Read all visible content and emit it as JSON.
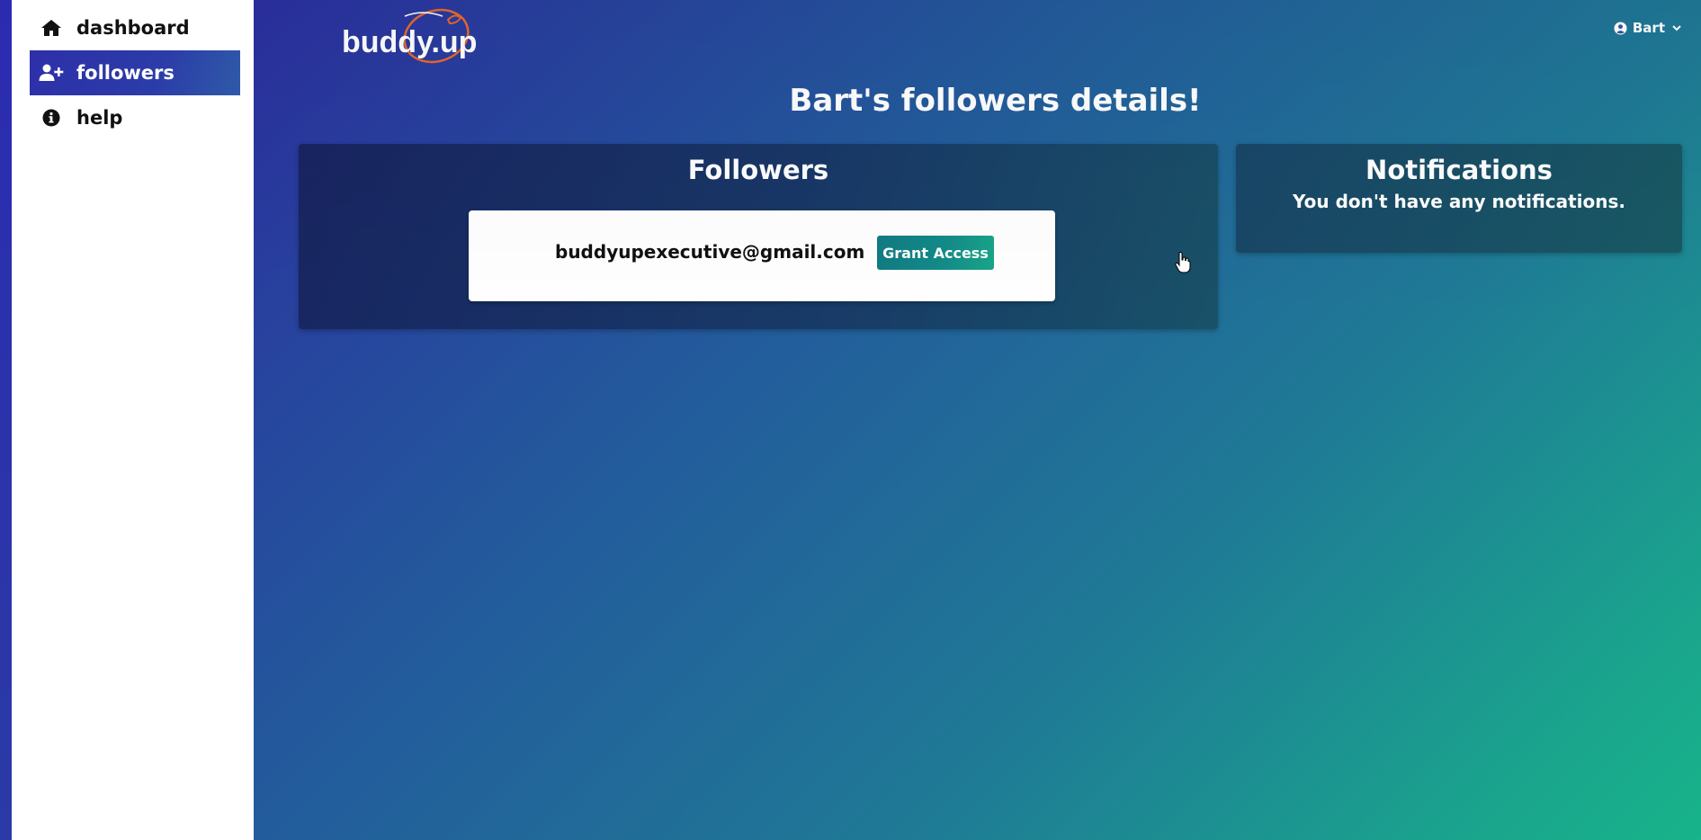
{
  "sidebar": {
    "items": [
      {
        "label": "dashboard",
        "icon": "home-icon"
      },
      {
        "label": "followers",
        "icon": "user-plus-icon",
        "active": true
      },
      {
        "label": "help",
        "icon": "info-circle-icon"
      }
    ]
  },
  "header": {
    "logo": "buddy.up",
    "user": "Bart"
  },
  "main": {
    "title": "Bart's followers details!",
    "followers": {
      "heading": "Followers",
      "list": [
        {
          "email": "buddyupexecutive@gmail.com",
          "action": "Grant Access"
        }
      ]
    },
    "notifications": {
      "heading": "Notifications",
      "message": "You don't have any notifications."
    }
  },
  "colors": {
    "accent": "#2e2fa9",
    "button": "#138c88",
    "gradient_start": "#2b2fa0",
    "gradient_end": "#17b38a"
  }
}
